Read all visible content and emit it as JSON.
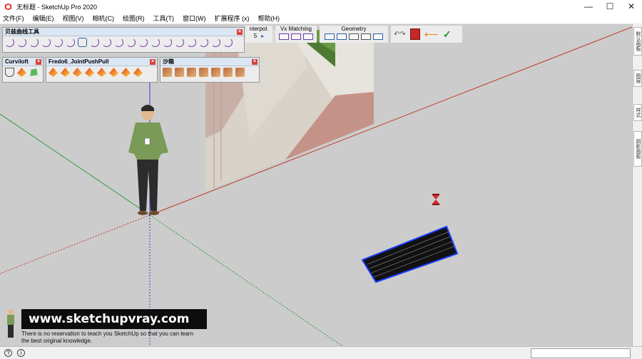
{
  "window": {
    "title": "无标题 - SketchUp Pro 2020",
    "buttons": [
      "—",
      "☐",
      "✕"
    ]
  },
  "menu": [
    "文件(F)",
    "编辑(E)",
    "视图(V)",
    "相机(C)",
    "绘图(R)",
    "工具(T)",
    "窗口(W)",
    "扩展程序 (x)",
    "帮助(H)"
  ],
  "toolbars": {
    "bezier": {
      "title": "贝兹曲线工具"
    },
    "curviloft": {
      "title": "Curviloft"
    },
    "joint": {
      "title": "Fredo6_JointPushPull"
    },
    "sandbox": {
      "title": "沙箱"
    }
  },
  "top_toolbar": {
    "interpol_label": "nterpol.",
    "interpol_value": "5",
    "vx_label": "Vx Matching",
    "geometry_label": "Geometry"
  },
  "right_tabs": [
    "默认面板",
    "图层",
    "样式",
    "阴影面板"
  ],
  "watermark": {
    "site": "www.sketchupvray.com",
    "line1": "There is no reservation to teach you SketchUp so that you can learn",
    "line2": "the best original knowledge."
  },
  "status": {
    "left_icons": [
      "question-icon",
      "info-icon"
    ]
  },
  "colors": {
    "axis_red": "#c0392b",
    "axis_green": "#2e9a3a",
    "axis_blue": "#3a3ad0",
    "sky": "#cccccc",
    "hatch_outline": "#1a3cff"
  }
}
